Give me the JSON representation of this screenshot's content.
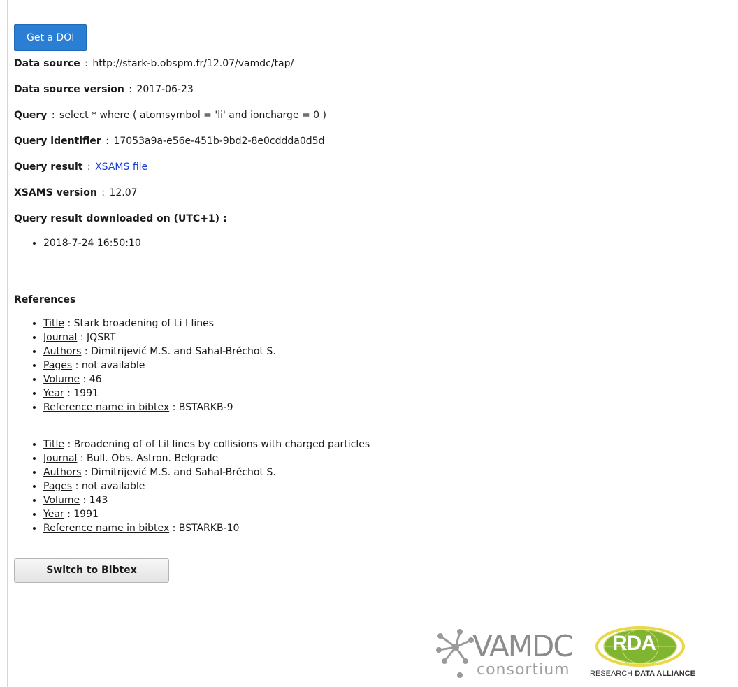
{
  "doi_button": "Get a DOI",
  "meta": {
    "data_source_label": "Data source",
    "data_source_value": "http://stark-b.obspm.fr/12.07/vamdc/tap/",
    "data_source_version_label": "Data source version",
    "data_source_version_value": "2017-06-23",
    "query_label": "Query",
    "query_value": "select * where ( atomsymbol = 'li' and ioncharge = 0 )",
    "query_identifier_label": "Query identifier",
    "query_identifier_value": "17053a9a-e56e-451b-9bd2-8e0cddda0d5d",
    "query_result_label": "Query result",
    "query_result_link": "XSAMS file",
    "xsams_version_label": "XSAMS version",
    "xsams_version_value": "12.07",
    "downloaded_on_label": "Query result downloaded on (UTC+1) :",
    "downloaded_on_dates": [
      "2018-7-24 16:50:10"
    ]
  },
  "references_heading": "References",
  "references": [
    {
      "title_label": "Title",
      "title": "Stark broadening of Li I lines",
      "journal_label": "Journal",
      "journal": "JQSRT",
      "authors_label": "Authors",
      "authors": "Dimitrijević M.S. and Sahal-Bréchot S.",
      "pages_label": "Pages",
      "pages": "not available",
      "volume_label": "Volume",
      "volume": "46",
      "year_label": "Year",
      "year": "1991",
      "bibtex_label": "Reference name in bibtex",
      "bibtex": "BSTARKB-9"
    },
    {
      "title_label": "Title",
      "title": "Broadening of of LiI lines by collisions with charged particles",
      "journal_label": "Journal",
      "journal": "Bull. Obs. Astron. Belgrade",
      "authors_label": "Authors",
      "authors": "Dimitrijević M.S. and Sahal-Bréchot S.",
      "pages_label": "Pages",
      "pages": "not available",
      "volume_label": "Volume",
      "volume": "143",
      "year_label": "Year",
      "year": "1991",
      "bibtex_label": "Reference name in bibtex",
      "bibtex": "BSTARKB-10"
    }
  ],
  "switch_button": "Switch to Bibtex",
  "logos": {
    "vamdc_word": "VAMDC",
    "vamdc_sub": "consortium",
    "rda_mark": "RDA",
    "rda_sub_plain": "RESEARCH",
    "rda_sub_bold": "DATA ALLIANCE"
  },
  "colors": {
    "doi_button": "#2a7ed3",
    "link": "#1a3ed8",
    "rda_globe": "#7fb531",
    "rda_ring": "#e8d84a"
  },
  "icons": [
    "vamdc-star-icon",
    "rda-globe-icon"
  ]
}
